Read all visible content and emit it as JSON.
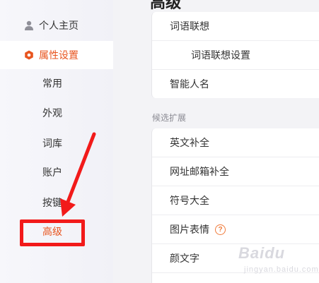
{
  "sidebar": {
    "profile_label": "个人主页",
    "settings_label": "属性设置",
    "sub_items": [
      "常用",
      "外观",
      "词库",
      "账户",
      "按键",
      "高级"
    ],
    "active_sub": "高级",
    "accent_color": "#e8551f",
    "annotation_color": "#f21a1a"
  },
  "main": {
    "page_title": "高级",
    "card1_rows": [
      "词语联想",
      "词语联想设置",
      "智能人名"
    ],
    "section_label": "候选扩展",
    "card2_rows": [
      "英文补全",
      "网址邮箱补全",
      "符号大全",
      "图片表情",
      "颜文字"
    ],
    "help_glyph": "?"
  },
  "watermark": {
    "brand": "Baidu",
    "sub": "jingyan.baidu.com"
  }
}
